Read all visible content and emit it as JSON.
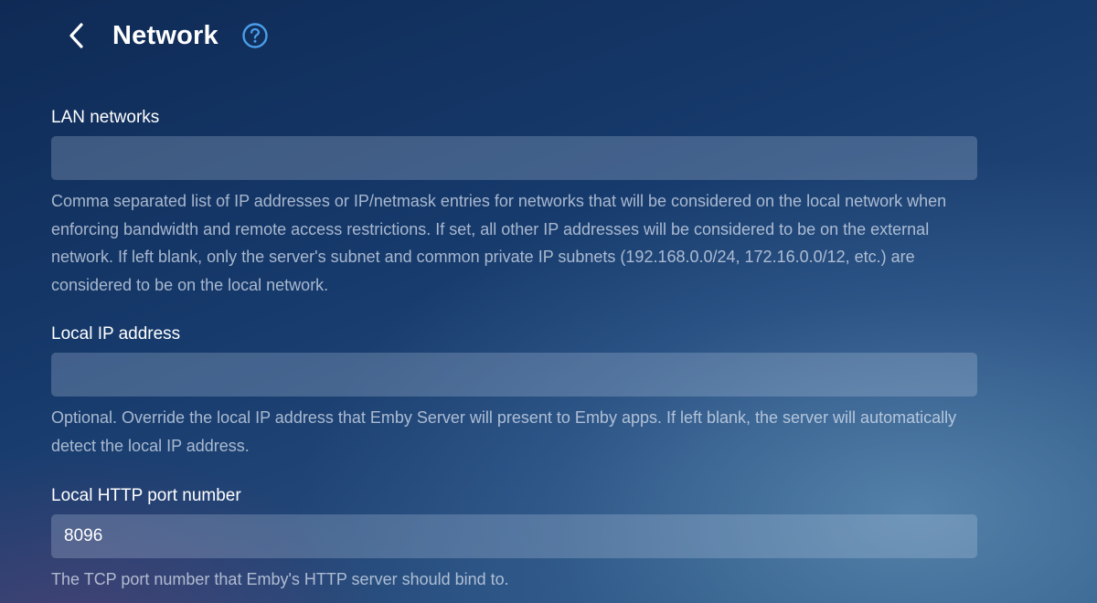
{
  "header": {
    "title": "Network",
    "back_icon": "chevron-left-icon",
    "help_icon": "help-circle-icon"
  },
  "fields": {
    "lan_networks": {
      "label": "LAN networks",
      "value": "",
      "description": "Comma separated list of IP addresses or IP/netmask entries for networks that will be considered on the local network when enforcing bandwidth and remote access restrictions. If set, all other IP addresses will be considered to be on the external network. If left blank, only the server's subnet and common private IP subnets (192.168.0.0/24, 172.16.0.0/12, etc.) are considered to be on the local network."
    },
    "local_ip": {
      "label": "Local IP address",
      "value": "",
      "description": "Optional. Override the local IP address that Emby Server will present to Emby apps. If left blank, the server will automatically detect the local IP address."
    },
    "http_port": {
      "label": "Local HTTP port number",
      "value": "8096",
      "description": "The TCP port number that Emby's HTTP server should bind to."
    }
  },
  "colors": {
    "accent": "#4a9eea",
    "text": "#ffffff",
    "secondary_text": "#c5cedb"
  }
}
